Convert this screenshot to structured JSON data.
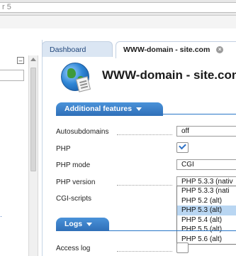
{
  "topbar": {
    "search_text": "r 5"
  },
  "leftpane": {
    "collapse_glyph": "–",
    "pin_glyph": "📌"
  },
  "tabs": [
    {
      "label": "Dashboard"
    },
    {
      "label": "WWW-domain - site.com"
    }
  ],
  "header": {
    "title": "WWW-domain - site.com"
  },
  "sections": {
    "additional": "Additional features",
    "logs": "Logs"
  },
  "fields": {
    "autosubdomains": {
      "label": "Autosubdomains",
      "value": "off"
    },
    "php": {
      "label": "PHP",
      "checked": true
    },
    "php_mode": {
      "label": "PHP mode",
      "value": "CGI"
    },
    "php_version": {
      "label": "PHP version",
      "value": "PHP 5.3.3 (nativ"
    },
    "cgi": {
      "label": "CGI-scripts"
    },
    "access_log": {
      "label": "Access log"
    }
  },
  "php_version_options": [
    {
      "label": "PHP 5.3.3 (nati",
      "selected": false
    },
    {
      "label": "PHP 5.2 (alt)",
      "selected": false
    },
    {
      "label": "PHP 5.3 (alt)",
      "selected": true
    },
    {
      "label": "PHP 5.4 (alt)",
      "selected": false
    },
    {
      "label": "PHP 5.5 (alt)",
      "selected": false
    },
    {
      "label": "PHP 5.6 (alt)",
      "selected": false
    }
  ],
  "colors": {
    "accent": "#2f6fb8",
    "tab_bg": "#dbe6f3",
    "selected_option": "#b9d6f2"
  }
}
